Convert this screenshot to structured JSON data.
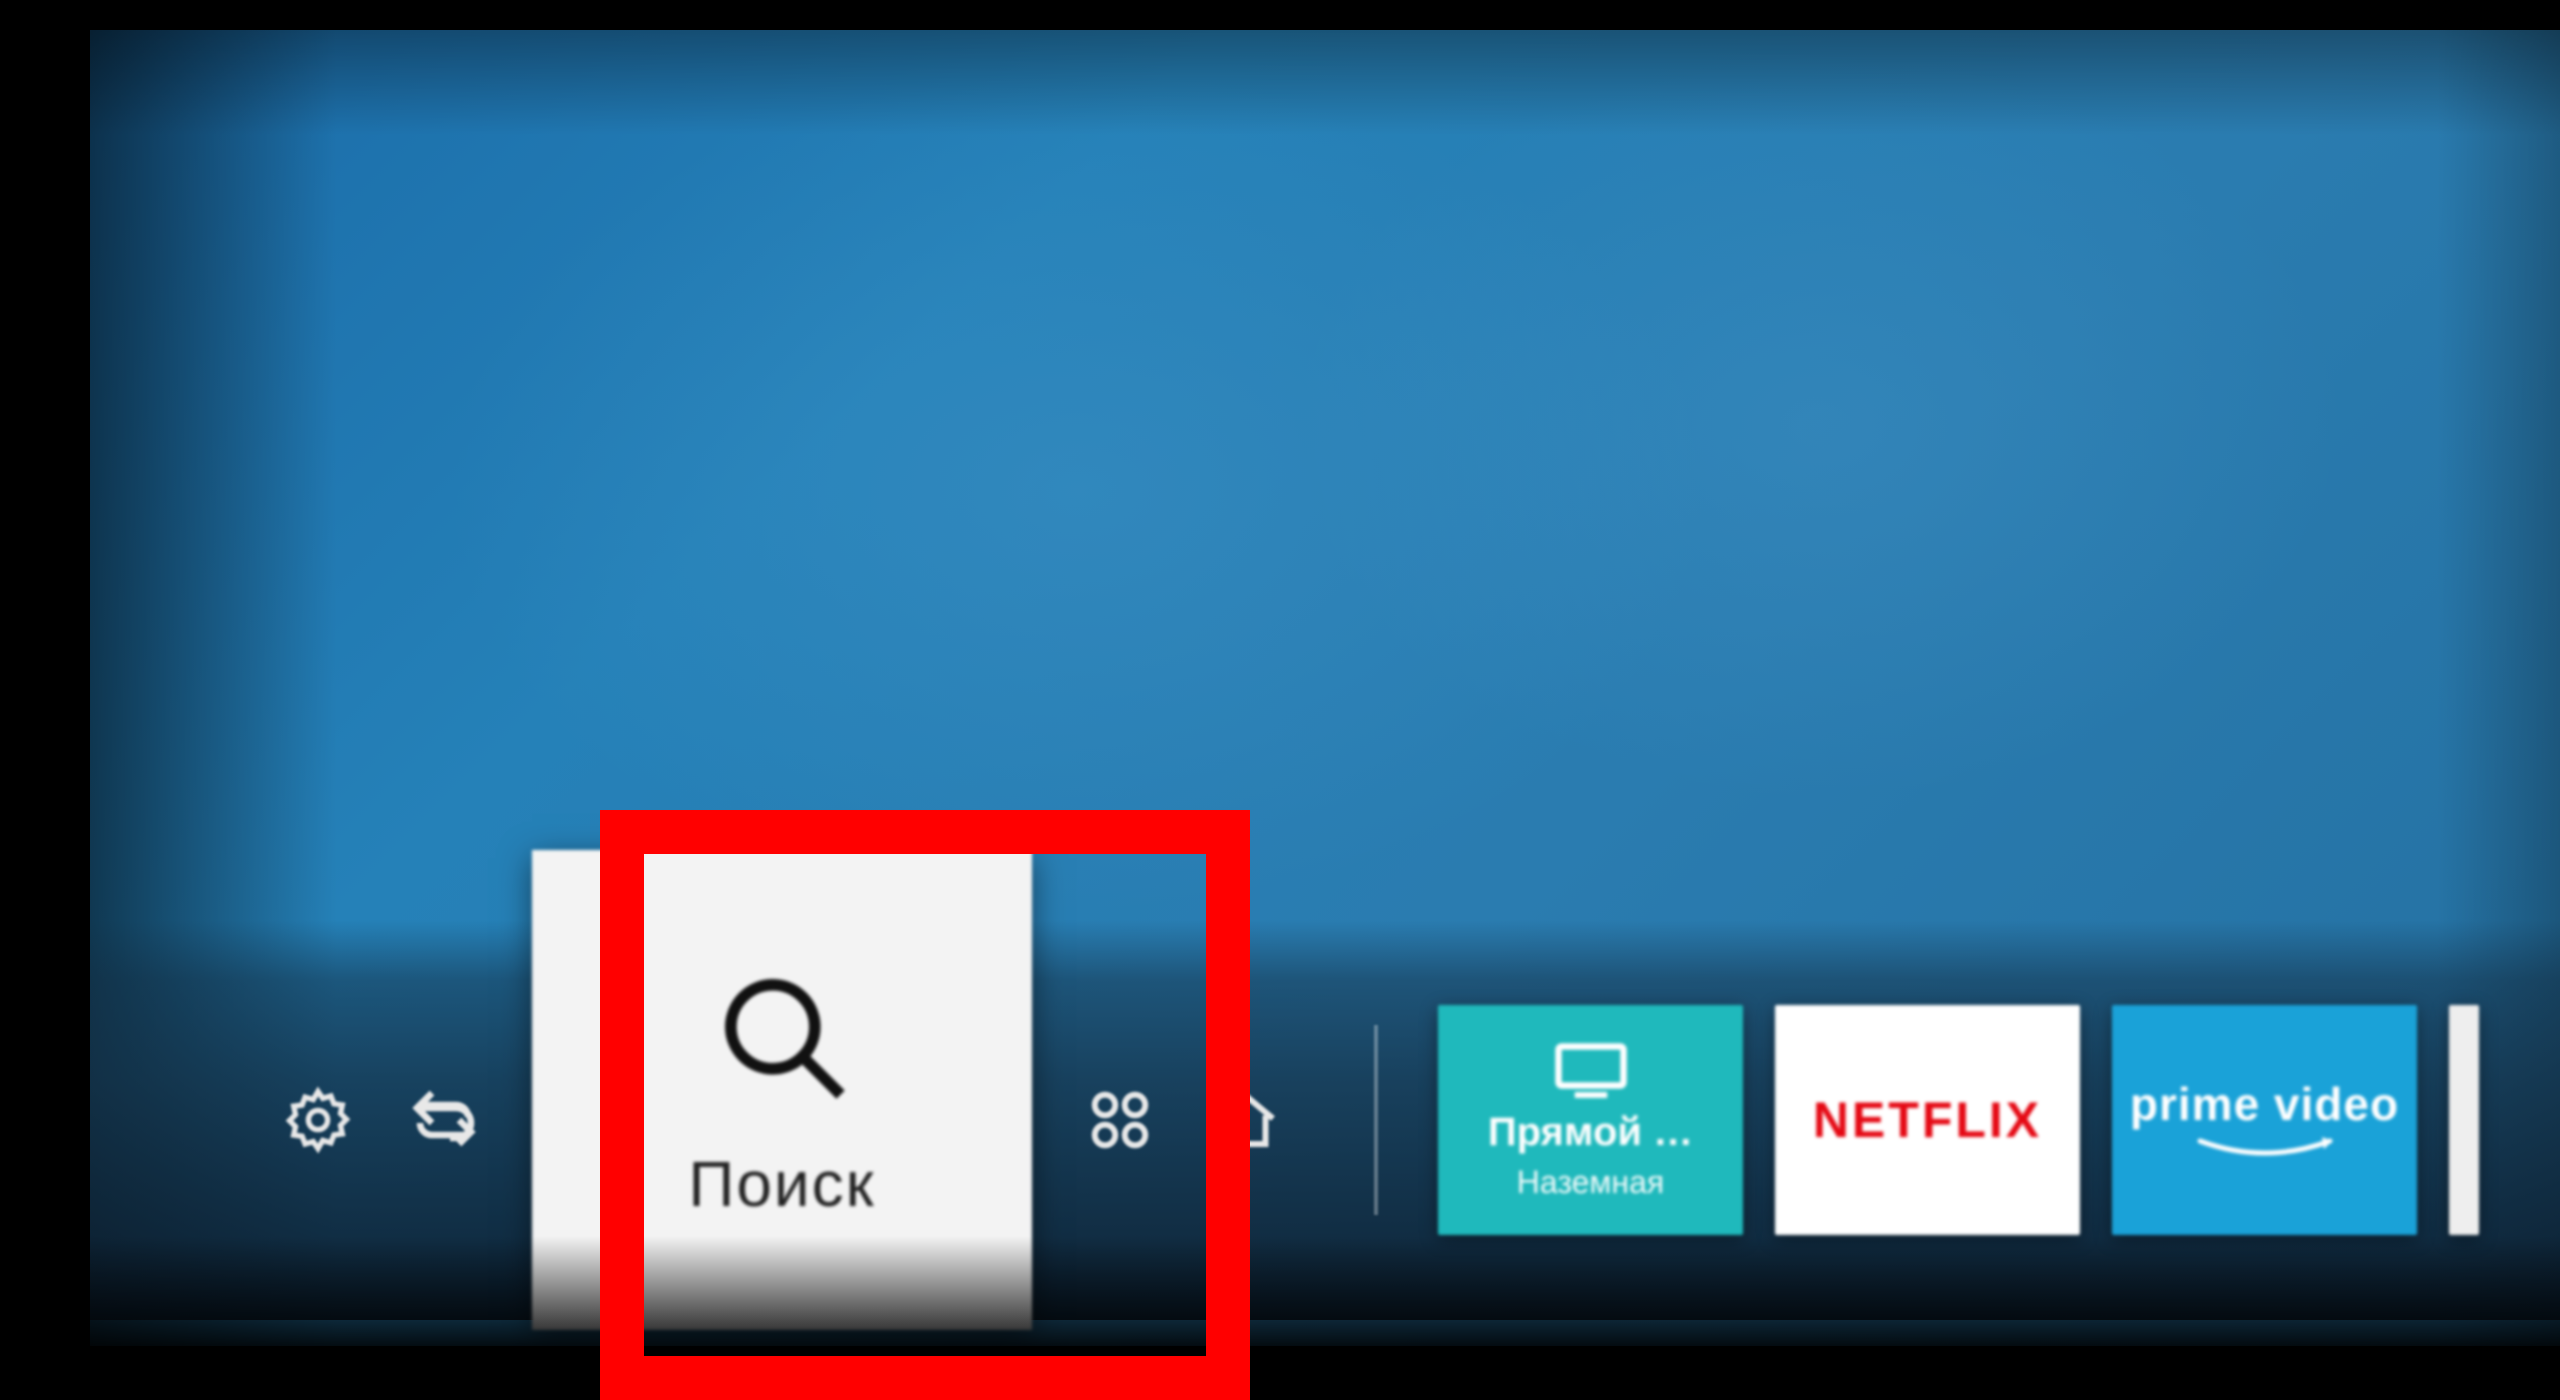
{
  "launcher": {
    "icons": {
      "settings": "settings-icon",
      "source": "source-icon",
      "apps": "apps-icon",
      "home": "home-icon"
    },
    "search": {
      "label": "Поиск"
    },
    "apps": [
      {
        "id": "live-tv",
        "line1": "Прямой …",
        "line2": "Наземная",
        "bg": "#1fb9bc"
      },
      {
        "id": "netflix",
        "label": "NETFLIX",
        "bg": "#ffffff",
        "fg": "#e50914"
      },
      {
        "id": "prime-video",
        "label": "prime video",
        "bg": "#1aa2d8"
      }
    ]
  },
  "colors": {
    "highlight": "#ff0000",
    "screen_blue": "#2581b8"
  }
}
